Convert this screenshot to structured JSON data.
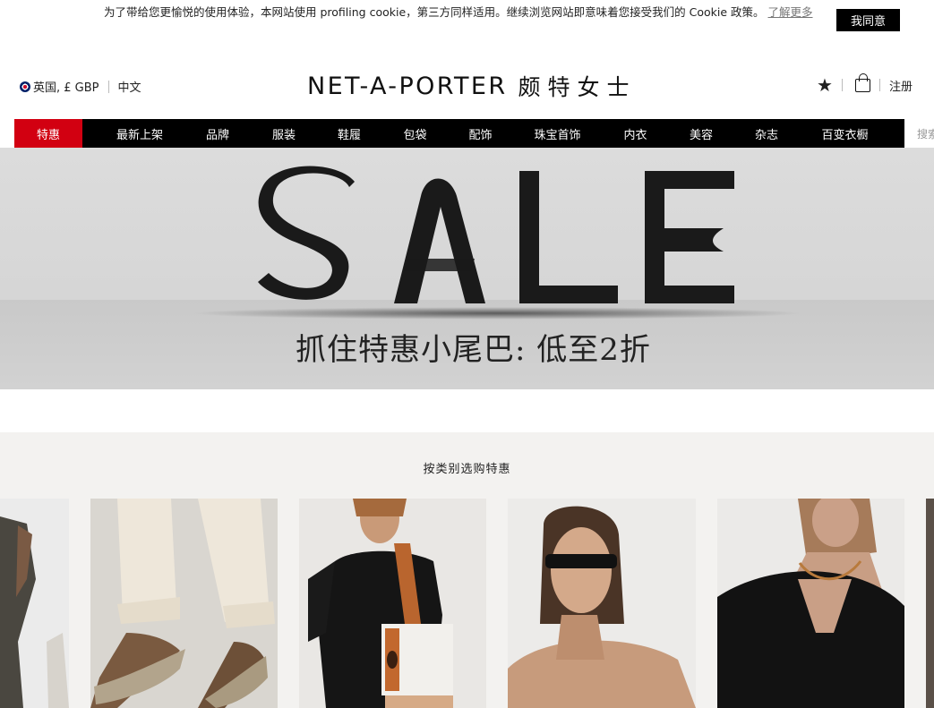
{
  "cookie": {
    "text": "为了带给您更愉悦的使用体验，本网站使用 profiling cookie，第三方同样适用。继续浏览网站即意味着您接受我们的 Cookie 政策。",
    "learn_more": "了解更多",
    "accept_label": "我同意"
  },
  "header": {
    "locale": "英国, £ GBP",
    "language": "中文",
    "logo_en": "NET-A-PORTER",
    "logo_cn": "颇特女士",
    "register": "注册",
    "icons": [
      "flag-icon",
      "star-icon",
      "bag-icon"
    ]
  },
  "nav": {
    "items": [
      {
        "label": "特惠",
        "highlight": true
      },
      {
        "label": "最新上架"
      },
      {
        "label": "品牌"
      },
      {
        "label": "服装"
      },
      {
        "label": "鞋履"
      },
      {
        "label": "包袋"
      },
      {
        "label": "配饰"
      },
      {
        "label": "珠宝首饰"
      },
      {
        "label": "内衣"
      },
      {
        "label": "美容"
      },
      {
        "label": "杂志"
      },
      {
        "label": "百变衣橱"
      }
    ],
    "search_placeholder": "搜索"
  },
  "hero": {
    "title": "SALE",
    "subtitle": "抓住特惠小尾巴: 低至2折"
  },
  "category": {
    "title": "按类别选购特惠",
    "cards": [
      "dress-card",
      "shoes-card",
      "bags-card",
      "sunglasses-card",
      "jewellery-card"
    ]
  },
  "colors": {
    "sale_red": "#d20011",
    "nav_black": "#000000",
    "section_bg": "#f3f2f0"
  }
}
